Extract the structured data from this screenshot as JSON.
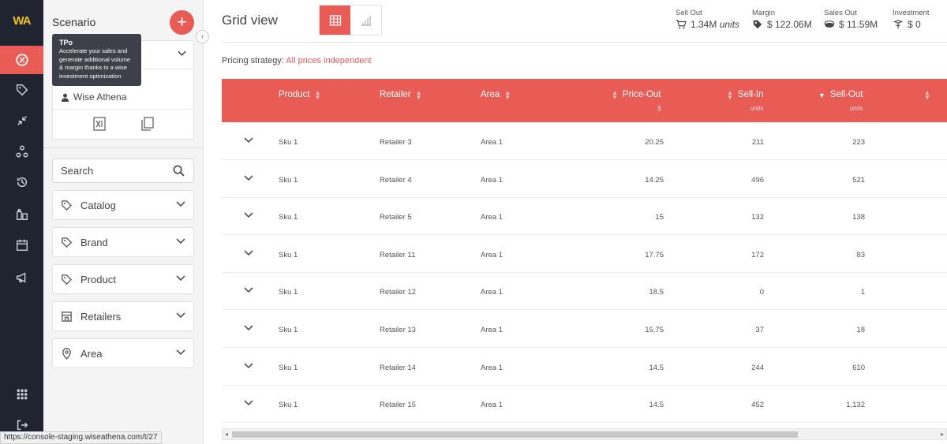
{
  "rail": {
    "logo": "WA",
    "items": [
      {
        "icon": "tpo-icon",
        "active": true
      },
      {
        "icon": "tag-icon",
        "active": false
      },
      {
        "icon": "shrink-icon",
        "active": false
      },
      {
        "icon": "network-icon",
        "active": false
      },
      {
        "icon": "history-icon",
        "active": false
      },
      {
        "icon": "bottles-icon",
        "active": false
      },
      {
        "icon": "calendar-icon",
        "active": false
      },
      {
        "icon": "megaphone-icon",
        "active": false
      }
    ],
    "bottom": [
      "apps-grid-icon",
      "logout-icon"
    ]
  },
  "sidebar": {
    "title": "Scenario",
    "add_label": "+",
    "collapse_label": "‹",
    "tooltip": {
      "title": "TPo",
      "body": "Accelerate your sales and generate additional volume & margin thanks to a wise investment optimization"
    },
    "owner": "Wise Athena",
    "search_placeholder": "Search",
    "filters": [
      {
        "label": "Catalog",
        "icon": "tag-icon"
      },
      {
        "label": "Brand",
        "icon": "tag-icon"
      },
      {
        "label": "Product",
        "icon": "tag-icon"
      },
      {
        "label": "Retailers",
        "icon": "store-icon"
      },
      {
        "label": "Area",
        "icon": "location-pin-icon"
      }
    ]
  },
  "main": {
    "title": "Grid view",
    "kpis": [
      {
        "label": "Sell Out",
        "value": "1.34M",
        "unit": "units",
        "icon": "cart-icon"
      },
      {
        "label": "Margin",
        "value": "$ 122.06M",
        "unit": "",
        "icon": "price-tag-icon"
      },
      {
        "label": "Sales Out",
        "value": "$ 11.59M",
        "unit": "",
        "icon": "money-icon"
      },
      {
        "label": "Investment",
        "value": "$ 0",
        "unit": "",
        "icon": "piggy-icon"
      }
    ],
    "pricing_label": "Pricing strategy:",
    "pricing_value": "All prices independent",
    "columns": [
      {
        "label": "Product",
        "sub": ""
      },
      {
        "label": "Retailer",
        "sub": ""
      },
      {
        "label": "Area",
        "sub": ""
      },
      {
        "label": "Price-Out",
        "sub": "$"
      },
      {
        "label": "Sell-In",
        "sub": "units"
      },
      {
        "label": "Sell-Out",
        "sub": "units"
      }
    ],
    "rows": [
      {
        "product": "Sku 1",
        "retailer": "Retailer 3",
        "area": "Area 1",
        "price_out": "20.25",
        "sell_in": "211",
        "sell_out": "223"
      },
      {
        "product": "Sku 1",
        "retailer": "Retailer 4",
        "area": "Area 1",
        "price_out": "14.25",
        "sell_in": "496",
        "sell_out": "521"
      },
      {
        "product": "Sku 1",
        "retailer": "Retailer 5",
        "area": "Area 1",
        "price_out": "15",
        "sell_in": "132",
        "sell_out": "138"
      },
      {
        "product": "Sku 1",
        "retailer": "Retailer 11",
        "area": "Area 1",
        "price_out": "17.75",
        "sell_in": "172",
        "sell_out": "83"
      },
      {
        "product": "Sku 1",
        "retailer": "Retailer 12",
        "area": "Area 1",
        "price_out": "18.5",
        "sell_in": "0",
        "sell_out": "1"
      },
      {
        "product": "Sku 1",
        "retailer": "Retailer 13",
        "area": "Area 1",
        "price_out": "15.75",
        "sell_in": "37",
        "sell_out": "18"
      },
      {
        "product": "Sku 1",
        "retailer": "Retailer 14",
        "area": "Area 1",
        "price_out": "14.5",
        "sell_in": "244",
        "sell_out": "610"
      },
      {
        "product": "Sku 1",
        "retailer": "Retailer 15",
        "area": "Area 1",
        "price_out": "14.5",
        "sell_in": "452",
        "sell_out": "1,132"
      }
    ]
  },
  "statusbar": "https://console-staging.wiseathena.com/t/27",
  "colors": {
    "accent": "#e95b55",
    "rail": "#1f2430"
  }
}
